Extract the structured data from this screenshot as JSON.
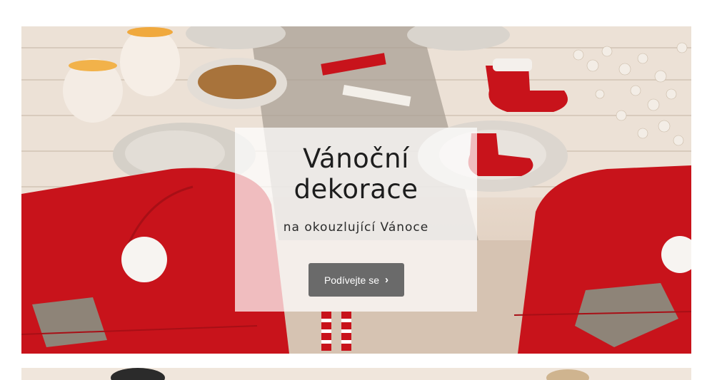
{
  "hero": {
    "title_line1": "Vánoční",
    "title_line2": "dekorace",
    "subtitle": "na okouzlující Vánoce",
    "button_label": "Podívejte se",
    "button_icon": "chevron-right-icon",
    "colors": {
      "accent_red": "#c8131b",
      "button_bg": "#6a6a6a",
      "card_bg": "#ffffff"
    }
  }
}
